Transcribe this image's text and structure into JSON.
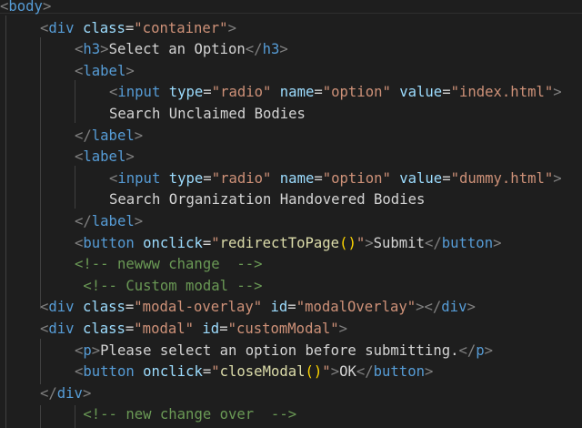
{
  "lines": [
    {
      "indent": 0,
      "tokens": [
        {
          "t": "<",
          "c": "punc"
        },
        {
          "t": "body",
          "c": "tag"
        },
        {
          "t": ">",
          "c": "punc"
        }
      ]
    },
    {
      "indent": 1,
      "tokens": [
        {
          "t": "<",
          "c": "punc"
        },
        {
          "t": "div",
          "c": "tag"
        },
        {
          "t": " ",
          "c": "text"
        },
        {
          "t": "class",
          "c": "attr"
        },
        {
          "t": "=",
          "c": "text"
        },
        {
          "t": "\"container\"",
          "c": "str"
        },
        {
          "t": ">",
          "c": "punc"
        }
      ]
    },
    {
      "indent": 2,
      "tokens": [
        {
          "t": "<",
          "c": "punc"
        },
        {
          "t": "h3",
          "c": "tag"
        },
        {
          "t": ">",
          "c": "punc"
        },
        {
          "t": "Select an Option",
          "c": "text"
        },
        {
          "t": "</",
          "c": "punc"
        },
        {
          "t": "h3",
          "c": "tag"
        },
        {
          "t": ">",
          "c": "punc"
        }
      ]
    },
    {
      "indent": 2,
      "tokens": [
        {
          "t": "<",
          "c": "punc"
        },
        {
          "t": "label",
          "c": "tag"
        },
        {
          "t": ">",
          "c": "punc"
        }
      ]
    },
    {
      "indent": 3,
      "tokens": [
        {
          "t": "<",
          "c": "punc"
        },
        {
          "t": "input",
          "c": "tag"
        },
        {
          "t": " ",
          "c": "text"
        },
        {
          "t": "type",
          "c": "attr"
        },
        {
          "t": "=",
          "c": "text"
        },
        {
          "t": "\"radio\"",
          "c": "str"
        },
        {
          "t": " ",
          "c": "text"
        },
        {
          "t": "name",
          "c": "attr"
        },
        {
          "t": "=",
          "c": "text"
        },
        {
          "t": "\"option\"",
          "c": "str"
        },
        {
          "t": " ",
          "c": "text"
        },
        {
          "t": "value",
          "c": "attr"
        },
        {
          "t": "=",
          "c": "text"
        },
        {
          "t": "\"index.html\"",
          "c": "str"
        },
        {
          "t": ">",
          "c": "punc"
        }
      ]
    },
    {
      "indent": 3,
      "tokens": [
        {
          "t": "Search Unclaimed Bodies",
          "c": "text"
        }
      ]
    },
    {
      "indent": 2,
      "tokens": [
        {
          "t": "</",
          "c": "punc"
        },
        {
          "t": "label",
          "c": "tag"
        },
        {
          "t": ">",
          "c": "punc"
        }
      ]
    },
    {
      "indent": 2,
      "tokens": [
        {
          "t": "<",
          "c": "punc"
        },
        {
          "t": "label",
          "c": "tag"
        },
        {
          "t": ">",
          "c": "punc"
        }
      ]
    },
    {
      "indent": 3,
      "tokens": [
        {
          "t": "<",
          "c": "punc"
        },
        {
          "t": "input",
          "c": "tag"
        },
        {
          "t": " ",
          "c": "text"
        },
        {
          "t": "type",
          "c": "attr"
        },
        {
          "t": "=",
          "c": "text"
        },
        {
          "t": "\"radio\"",
          "c": "str"
        },
        {
          "t": " ",
          "c": "text"
        },
        {
          "t": "name",
          "c": "attr"
        },
        {
          "t": "=",
          "c": "text"
        },
        {
          "t": "\"option\"",
          "c": "str"
        },
        {
          "t": " ",
          "c": "text"
        },
        {
          "t": "value",
          "c": "attr"
        },
        {
          "t": "=",
          "c": "text"
        },
        {
          "t": "\"dummy.html\"",
          "c": "str"
        },
        {
          "t": ">",
          "c": "punc"
        }
      ]
    },
    {
      "indent": 3,
      "tokens": [
        {
          "t": "Search Organization Handovered Bodies",
          "c": "text"
        }
      ]
    },
    {
      "indent": 2,
      "tokens": [
        {
          "t": "</",
          "c": "punc"
        },
        {
          "t": "label",
          "c": "tag"
        },
        {
          "t": ">",
          "c": "punc"
        }
      ]
    },
    {
      "indent": 2,
      "tokens": [
        {
          "t": "<",
          "c": "punc"
        },
        {
          "t": "button",
          "c": "tag"
        },
        {
          "t": " ",
          "c": "text"
        },
        {
          "t": "onclick",
          "c": "attr"
        },
        {
          "t": "=",
          "c": "text"
        },
        {
          "t": "\"",
          "c": "str"
        },
        {
          "t": "redirectToPage",
          "c": "fn"
        },
        {
          "t": "()",
          "c": "paren"
        },
        {
          "t": "\"",
          "c": "str"
        },
        {
          "t": ">",
          "c": "punc"
        },
        {
          "t": "Submit",
          "c": "text"
        },
        {
          "t": "</",
          "c": "punc"
        },
        {
          "t": "button",
          "c": "tag"
        },
        {
          "t": ">",
          "c": "punc"
        }
      ]
    },
    {
      "indent": 2,
      "tokens": [
        {
          "t": "<!-- newww change  -->",
          "c": "comment"
        }
      ]
    },
    {
      "indent": 2,
      "pad": " ",
      "tokens": [
        {
          "t": "<!-- Custom modal -->",
          "c": "comment"
        }
      ]
    },
    {
      "indent": 1,
      "tokens": [
        {
          "t": "<",
          "c": "punc"
        },
        {
          "t": "div",
          "c": "tag"
        },
        {
          "t": " ",
          "c": "text"
        },
        {
          "t": "class",
          "c": "attr"
        },
        {
          "t": "=",
          "c": "text"
        },
        {
          "t": "\"modal-overlay\"",
          "c": "str"
        },
        {
          "t": " ",
          "c": "text"
        },
        {
          "t": "id",
          "c": "attr"
        },
        {
          "t": "=",
          "c": "text"
        },
        {
          "t": "\"modalOverlay\"",
          "c": "str"
        },
        {
          "t": "></",
          "c": "punc"
        },
        {
          "t": "div",
          "c": "tag"
        },
        {
          "t": ">",
          "c": "punc"
        }
      ]
    },
    {
      "indent": 1,
      "tokens": [
        {
          "t": "<",
          "c": "punc"
        },
        {
          "t": "div",
          "c": "tag"
        },
        {
          "t": " ",
          "c": "text"
        },
        {
          "t": "class",
          "c": "attr"
        },
        {
          "t": "=",
          "c": "text"
        },
        {
          "t": "\"modal\"",
          "c": "str"
        },
        {
          "t": " ",
          "c": "text"
        },
        {
          "t": "id",
          "c": "attr"
        },
        {
          "t": "=",
          "c": "text"
        },
        {
          "t": "\"customModal\"",
          "c": "str"
        },
        {
          "t": ">",
          "c": "punc"
        }
      ]
    },
    {
      "indent": 2,
      "tokens": [
        {
          "t": "<",
          "c": "punc"
        },
        {
          "t": "p",
          "c": "tag"
        },
        {
          "t": ">",
          "c": "punc"
        },
        {
          "t": "Please select an option before submitting.",
          "c": "text"
        },
        {
          "t": "</",
          "c": "punc"
        },
        {
          "t": "p",
          "c": "tag"
        },
        {
          "t": ">",
          "c": "punc"
        }
      ]
    },
    {
      "indent": 2,
      "tokens": [
        {
          "t": "<",
          "c": "punc"
        },
        {
          "t": "button",
          "c": "tag"
        },
        {
          "t": " ",
          "c": "text"
        },
        {
          "t": "onclick",
          "c": "attr"
        },
        {
          "t": "=",
          "c": "text"
        },
        {
          "t": "\"",
          "c": "str"
        },
        {
          "t": "closeModal",
          "c": "fn"
        },
        {
          "t": "()",
          "c": "paren"
        },
        {
          "t": "\"",
          "c": "str"
        },
        {
          "t": ">",
          "c": "punc"
        },
        {
          "t": "OK",
          "c": "text"
        },
        {
          "t": "</",
          "c": "punc"
        },
        {
          "t": "button",
          "c": "tag"
        },
        {
          "t": ">",
          "c": "punc"
        }
      ]
    },
    {
      "indent": 1,
      "tokens": [
        {
          "t": "</",
          "c": "punc"
        },
        {
          "t": "div",
          "c": "tag"
        },
        {
          "t": ">",
          "c": "punc"
        }
      ]
    },
    {
      "indent": 2,
      "pad": " ",
      "tokens": [
        {
          "t": "<!-- new change over  -->",
          "c": "comment"
        }
      ]
    }
  ]
}
